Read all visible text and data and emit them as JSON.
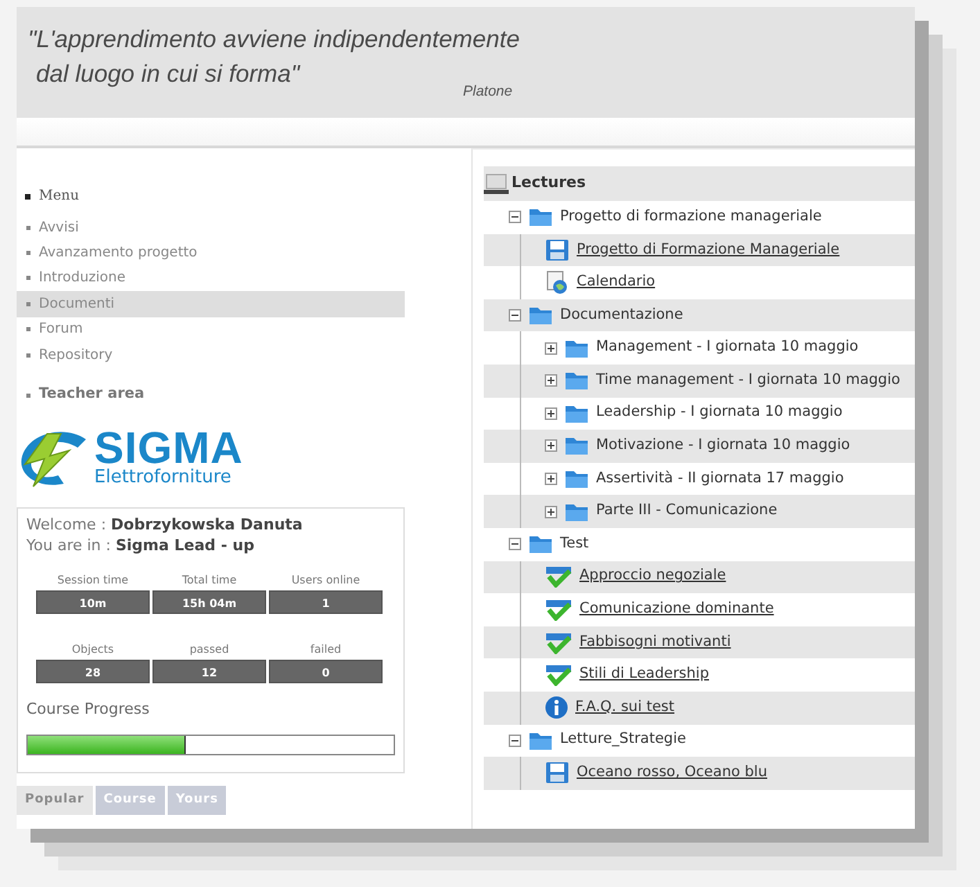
{
  "header": {
    "quote_lines": [
      "\"L'apprendimento avviene indipendentemente",
      "dal luogo in cui si forma\""
    ],
    "author": "Platone"
  },
  "menu": {
    "title": "Menu",
    "items": [
      {
        "label": "Avvisi",
        "selected": false
      },
      {
        "label": "Avanzamento progetto",
        "selected": false
      },
      {
        "label": "Introduzione",
        "selected": false
      },
      {
        "label": "Documenti",
        "selected": true
      },
      {
        "label": "Forum",
        "selected": false
      },
      {
        "label": "Repository",
        "selected": false
      }
    ],
    "section": "Teacher area"
  },
  "logo": {
    "name": "SIGMA",
    "subtitle": "Elettroforniture"
  },
  "user_box": {
    "welcome_label": "Welcome :",
    "user": "Dobrzykowska Danuta",
    "location_label": "You are in :",
    "location": "Sigma Lead - up",
    "stats": [
      [
        {
          "label": "Session time",
          "value": "10m"
        },
        {
          "label": "Total time",
          "value": "15h 04m"
        },
        {
          "label": "Users online",
          "value": "1"
        }
      ],
      [
        {
          "label": "Objects",
          "value": "28"
        },
        {
          "label": "passed",
          "value": "12"
        },
        {
          "label": "failed",
          "value": "0"
        }
      ]
    ],
    "progress_label": "Course Progress",
    "progress": {
      "level": 0.43
    }
  },
  "tabs": [
    {
      "label": "Popular",
      "selected": true
    },
    {
      "label": "Course",
      "selected": false
    },
    {
      "label": "Yours",
      "selected": false
    }
  ],
  "lectures": {
    "title": "Lectures",
    "tree": [
      {
        "kind": "folder",
        "label": "Progetto di formazione manageriale",
        "expanded": true,
        "children": [
          {
            "kind": "page",
            "label": "Progetto di Formazione Manageriale"
          },
          {
            "kind": "web",
            "label": "Calendario"
          }
        ]
      },
      {
        "kind": "folder",
        "label": "Documentazione",
        "expanded": true,
        "children": [
          {
            "kind": "folder",
            "label": "Management - I giornata 10 maggio",
            "expanded": false
          },
          {
            "kind": "folder",
            "label": "Time management - I giornata 10 maggio",
            "expanded": false
          },
          {
            "kind": "folder",
            "label": "Leadership - I giornata 10 maggio",
            "expanded": false
          },
          {
            "kind": "folder",
            "label": "Motivazione - I giornata 10 maggio",
            "expanded": false
          },
          {
            "kind": "folder",
            "label": "Assertività - II giornata 17 maggio",
            "expanded": false
          },
          {
            "kind": "folder",
            "label": "Parte III - Comunicazione",
            "expanded": false
          }
        ]
      },
      {
        "kind": "folder",
        "label": "Test",
        "expanded": true,
        "children": [
          {
            "kind": "test",
            "label": "Approccio negoziale"
          },
          {
            "kind": "test",
            "label": "Comunicazione dominante"
          },
          {
            "kind": "test",
            "label": "Fabbisogni motivanti"
          },
          {
            "kind": "test",
            "label": "Stili di Leadership"
          },
          {
            "kind": "info",
            "label": "F.A.Q. sui test"
          }
        ]
      },
      {
        "kind": "folder",
        "label": "Letture_Strategie",
        "expanded": true,
        "children": [
          {
            "kind": "page",
            "label": "Oceano rosso, Oceano blu"
          }
        ]
      }
    ]
  }
}
